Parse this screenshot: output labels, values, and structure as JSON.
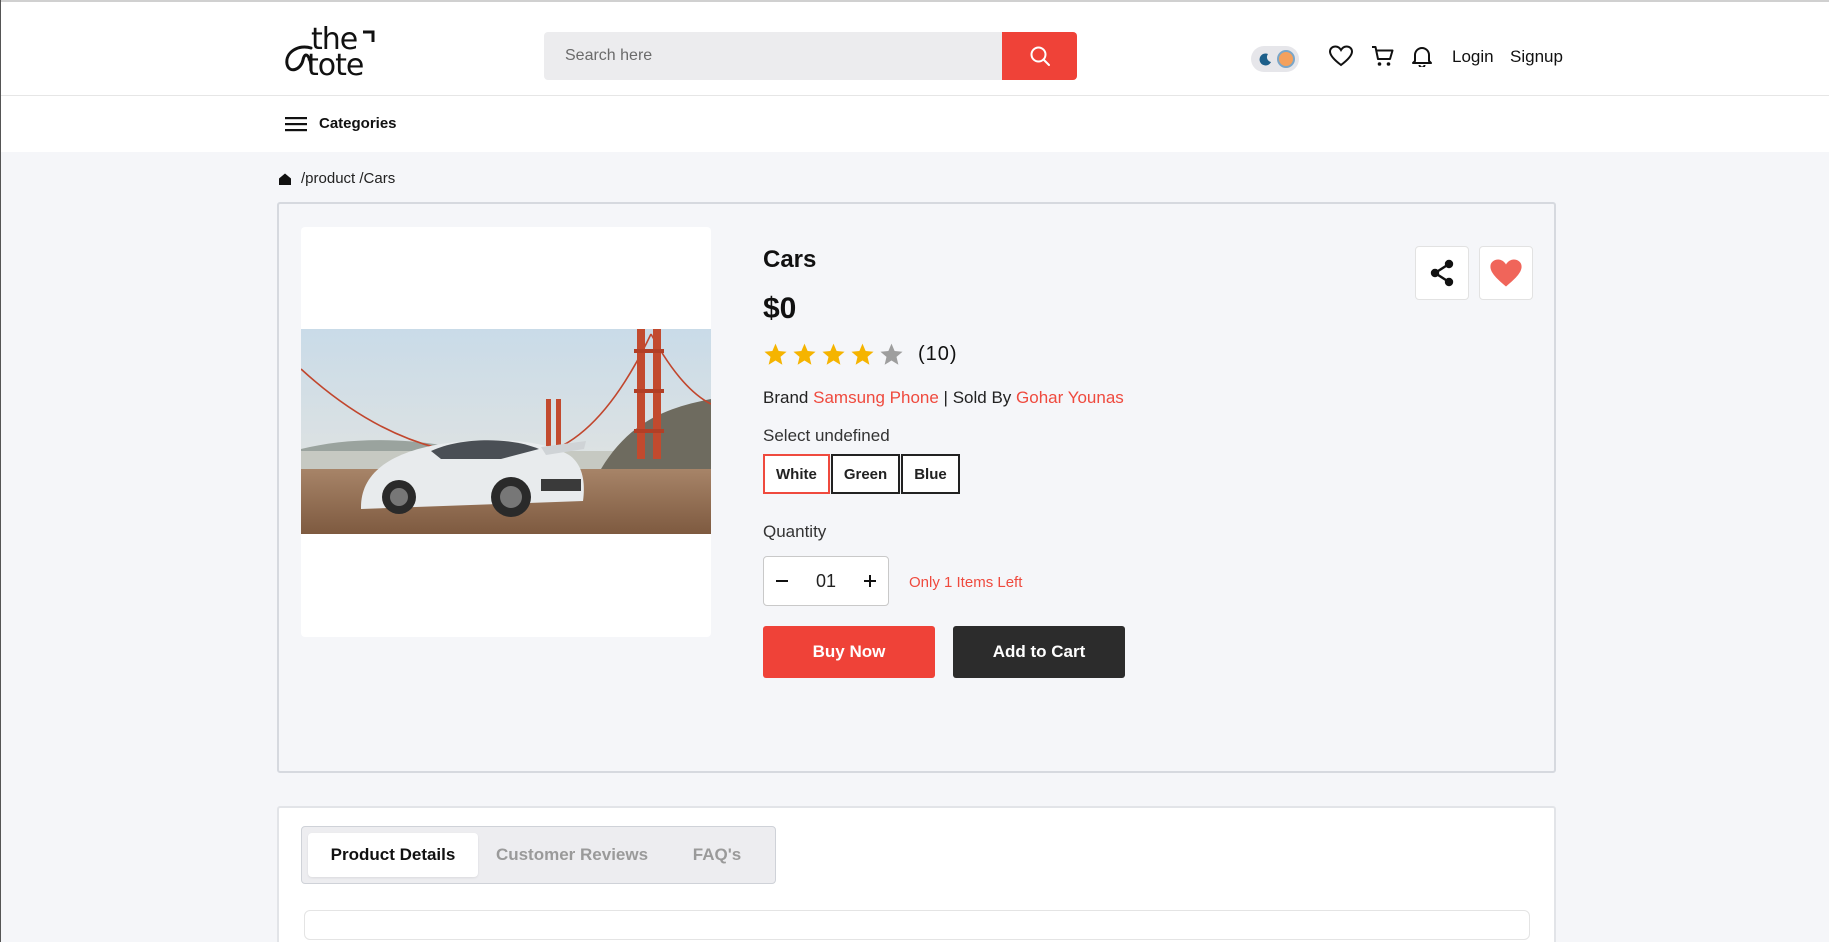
{
  "header": {
    "logo_text_top": "the",
    "logo_text_bottom": "tote",
    "search": {
      "placeholder": "Search here",
      "value": ""
    },
    "login_label": "Login",
    "signup_label": "Signup",
    "icons": [
      "moon-icon",
      "sun-icon",
      "heart-icon",
      "cart-icon",
      "bell-icon",
      "search-icon"
    ]
  },
  "catbar": {
    "label": "Categories"
  },
  "breadcrumb": {
    "path": "/product /Cars"
  },
  "product": {
    "title": "Cars",
    "price": "$0",
    "rating": 4,
    "rating_max": 5,
    "review_count": "(10)",
    "brand_prefix": "Brand",
    "brand": "Samsung Phone",
    "separator": "|",
    "sold_by_prefix": "Sold By",
    "seller": "Gohar Younas",
    "select_label": "Select undefined",
    "variants": [
      {
        "label": "White",
        "selected": true
      },
      {
        "label": "Green",
        "selected": false
      },
      {
        "label": "Blue",
        "selected": false
      }
    ],
    "quantity_label": "Quantity",
    "quantity": "01",
    "stock_note": "Only 1 Items Left",
    "buy_label": "Buy Now",
    "cart_label": "Add to Cart"
  },
  "tabs": [
    {
      "label": "Product Details",
      "active": true
    },
    {
      "label": "Customer Reviews",
      "active": false
    },
    {
      "label": "FAQ's",
      "active": false
    }
  ],
  "colors": {
    "accent": "#ef4238",
    "star": "#f5b400",
    "star_empty": "#9e9e9e",
    "dark_button": "#2c2c2c"
  }
}
